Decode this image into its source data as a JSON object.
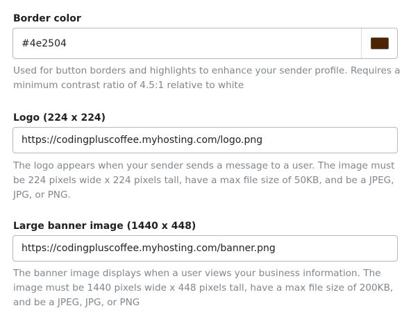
{
  "border_color": {
    "label": "Border color",
    "value": "#4e2504",
    "swatch_color": "#4e2504",
    "help": "Used for button borders and highlights to enhance your sender profile. Requires a minimum contrast ratio of 4.5:1 relative to white"
  },
  "logo": {
    "label": "Logo (224 x 224)",
    "value": "https://codingpluscoffee.myhosting.com/logo.png",
    "help": "The logo appears when your sender sends a message to a user. The image must be 224 pixels wide x 224 pixels tall, have a max file size of 50KB, and be a JPEG, JPG, or PNG."
  },
  "banner": {
    "label": "Large banner image (1440 x 448)",
    "value": "https://codingpluscoffee.myhosting.com/banner.png",
    "help": "The banner image displays when a user views your business information. The image must be 1440 pixels wide x 448 pixels tall, have a max file size of 200KB, and be a JPEG, JPG, or PNG"
  }
}
